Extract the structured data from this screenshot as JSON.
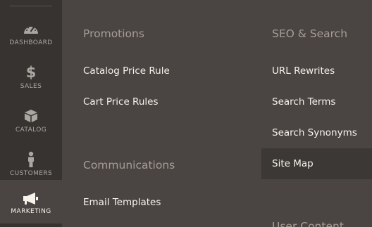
{
  "nav": {
    "items": [
      {
        "label": "DASHBOARD",
        "icon": "dashboard-icon"
      },
      {
        "label": "SALES",
        "icon": "dollar-icon"
      },
      {
        "label": "CATALOG",
        "icon": "box-icon"
      },
      {
        "label": "CUSTOMERS",
        "icon": "person-icon"
      },
      {
        "label": "MARKETING",
        "icon": "megaphone-icon"
      }
    ],
    "active": "MARKETING"
  },
  "menu": {
    "promotions": {
      "title": "Promotions",
      "links": [
        "Catalog Price Rule",
        "Cart Price Rules"
      ]
    },
    "communications": {
      "title": "Communications",
      "links": [
        "Email Templates"
      ]
    },
    "seo_search": {
      "title": "SEO & Search",
      "links": [
        "URL Rewrites",
        "Search Terms",
        "Search Synonyms",
        "Site Map"
      ],
      "hovered": "Site Map"
    },
    "user_content": {
      "title": "User Content"
    }
  },
  "colors": {
    "nav_bg": "#373330",
    "panel_bg": "#4a4542",
    "hover_bg": "#3c3835",
    "group_title": "#a79d95",
    "link_text": "#f7f3eb",
    "nav_label": "#aaa6a0"
  }
}
